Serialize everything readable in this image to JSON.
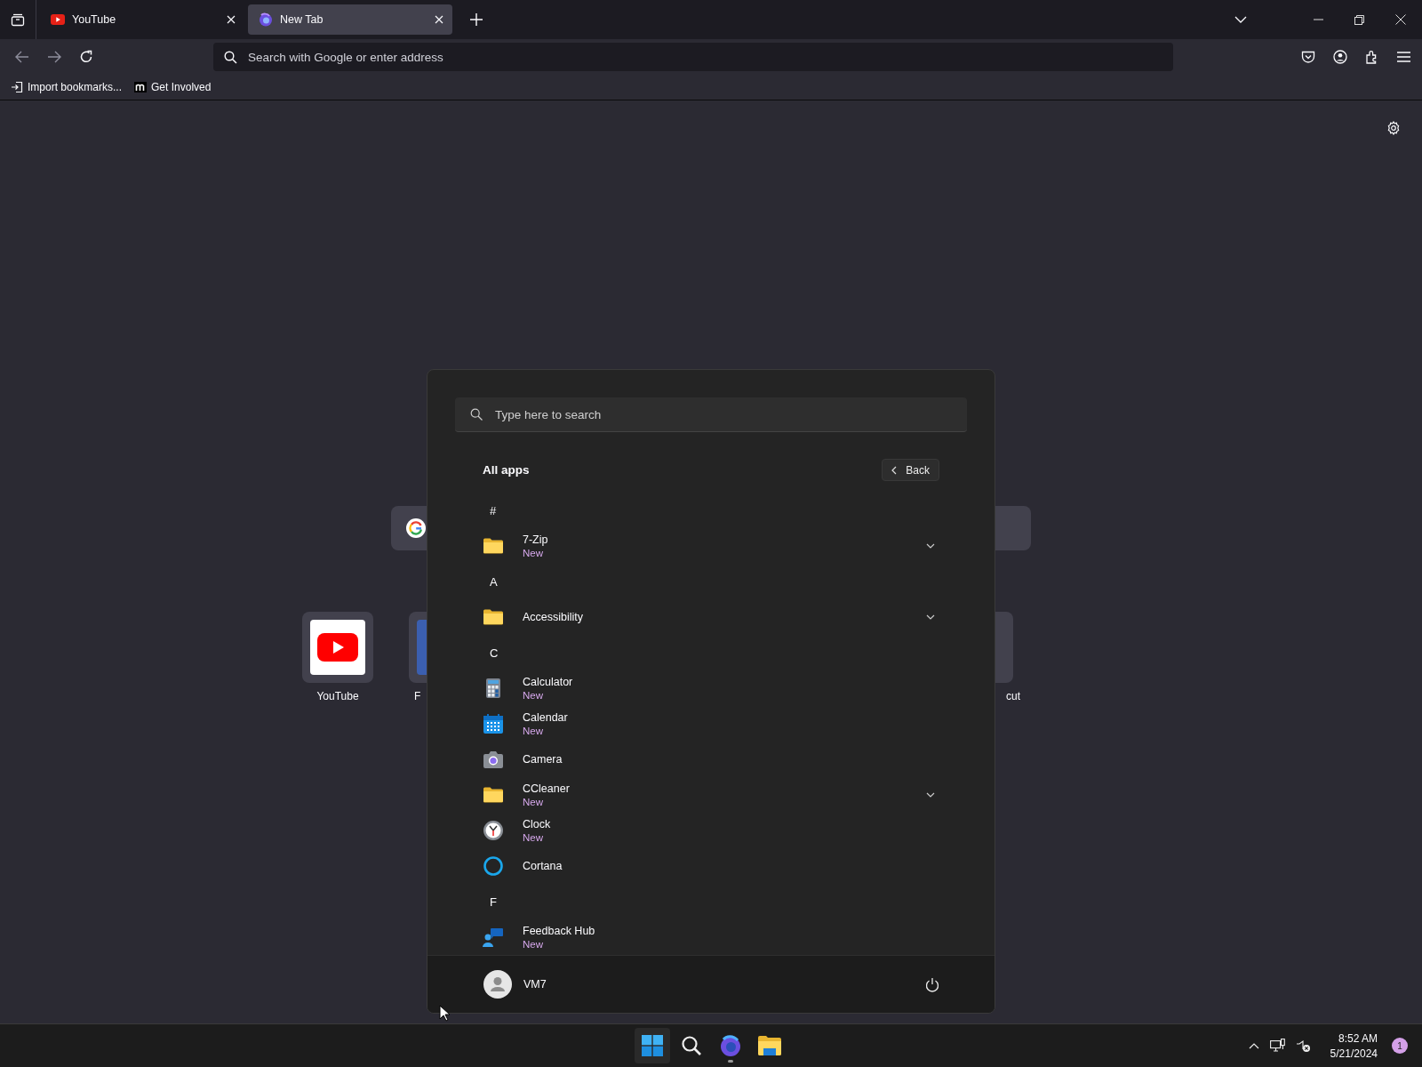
{
  "browser": {
    "tabs": [
      {
        "title": "YouTube",
        "selected": false
      },
      {
        "title": "New Tab",
        "selected": true
      }
    ],
    "address_bar": {
      "placeholder": "Search with Google or enter address"
    },
    "bookmarks": [
      {
        "label": "Import bookmarks..."
      },
      {
        "label": "Get Involved"
      }
    ]
  },
  "new_tab": {
    "top_sites": [
      {
        "label": "YouTube"
      },
      {
        "label": "F"
      },
      {
        "label": "cut"
      }
    ]
  },
  "start_menu": {
    "search": {
      "placeholder": "Type here to search"
    },
    "title": "All apps",
    "back_button": "Back",
    "apps": [
      {
        "kind": "header",
        "label": "#"
      },
      {
        "kind": "app",
        "name": "7-Zip",
        "badge": "New",
        "expandable": true
      },
      {
        "kind": "header",
        "label": "A"
      },
      {
        "kind": "app",
        "name": "Accessibility",
        "expandable": true
      },
      {
        "kind": "header",
        "label": "C"
      },
      {
        "kind": "app",
        "name": "Calculator",
        "badge": "New",
        "expandable": false
      },
      {
        "kind": "app",
        "name": "Calendar",
        "badge": "New",
        "expandable": false
      },
      {
        "kind": "app",
        "name": "Camera",
        "expandable": false
      },
      {
        "kind": "app",
        "name": "CCleaner",
        "badge": "New",
        "expandable": true
      },
      {
        "kind": "app",
        "name": "Clock",
        "badge": "New",
        "expandable": false
      },
      {
        "kind": "app",
        "name": "Cortana",
        "expandable": false
      },
      {
        "kind": "header",
        "label": "F"
      },
      {
        "kind": "app",
        "name": "Feedback Hub",
        "badge": "New",
        "expandable": false
      }
    ],
    "user": {
      "name": "VM7"
    }
  },
  "taskbar": {
    "time": "8:52 AM",
    "date": "5/21/2024",
    "notification_count": "1"
  }
}
